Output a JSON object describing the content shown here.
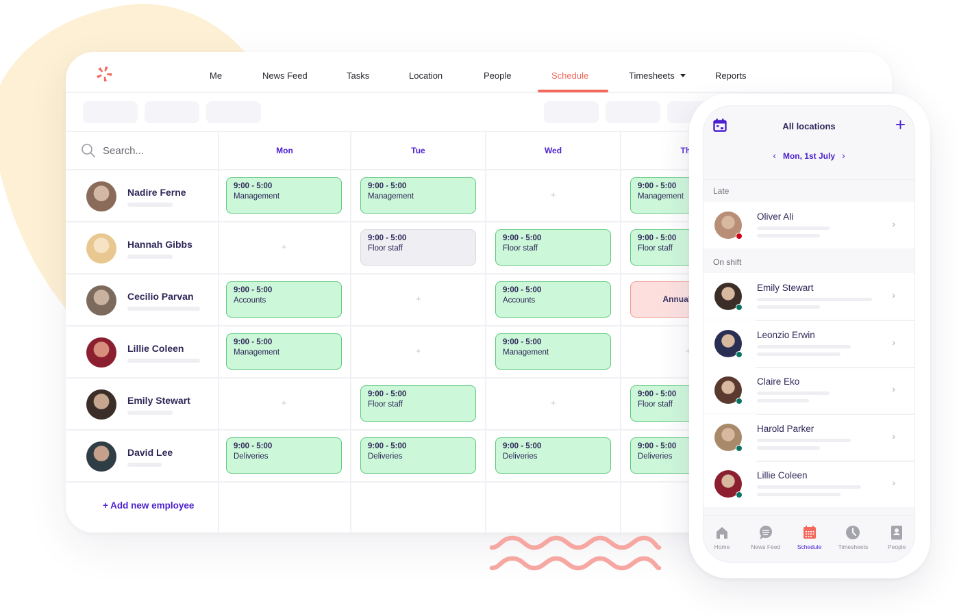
{
  "brand": {
    "accent": "#f4685d",
    "primary": "#4b1fcf",
    "text": "#2d2757",
    "shift_green": "#ccf7d9",
    "shift_grey": "#eeeef3",
    "shift_red": "#fde0de",
    "status_late": "#d0021b",
    "status_on_shift": "#0a7363"
  },
  "nav": {
    "logo": "asterisk-logo-icon",
    "items": [
      {
        "label": "Me"
      },
      {
        "label": "News Feed"
      },
      {
        "label": "Tasks"
      },
      {
        "label": "Location"
      },
      {
        "label": "People"
      },
      {
        "label": "Schedule",
        "active": true
      },
      {
        "label": "Timesheets",
        "has_dropdown": true
      },
      {
        "label": "Reports"
      }
    ]
  },
  "search": {
    "placeholder": "Search..."
  },
  "days": [
    "Mon",
    "Tue",
    "Wed",
    "Thu"
  ],
  "employees": [
    {
      "name": "Nadire Ferne",
      "shifts": [
        {
          "time": "9:00 - 5:00",
          "role": "Management",
          "state": "published"
        },
        {
          "time": "9:00 - 5:00",
          "role": "Management",
          "state": "published"
        },
        null,
        {
          "time": "9:00 - 5:00",
          "role": "Management",
          "state": "published"
        }
      ]
    },
    {
      "name": "Hannah Gibbs",
      "shifts": [
        null,
        {
          "time": "9:00 - 5:00",
          "role": "Floor staff",
          "state": "draft"
        },
        {
          "time": "9:00 - 5:00",
          "role": "Floor staff",
          "state": "published"
        },
        {
          "time": "9:00 - 5:00",
          "role": "Floor staff",
          "state": "published"
        }
      ]
    },
    {
      "name": "Cecilio Parvan",
      "shifts": [
        {
          "time": "9:00 - 5:00",
          "role": "Accounts",
          "state": "published"
        },
        null,
        {
          "time": "9:00 - 5:00",
          "role": "Accounts",
          "state": "published"
        },
        {
          "leave": "Annual leave",
          "state": "leave"
        }
      ]
    },
    {
      "name": "Lillie Coleen",
      "shifts": [
        {
          "time": "9:00 - 5:00",
          "role": "Management",
          "state": "published"
        },
        null,
        {
          "time": "9:00 - 5:00",
          "role": "Management",
          "state": "published"
        },
        null
      ]
    },
    {
      "name": "Emily Stewart",
      "shifts": [
        null,
        {
          "time": "9:00 - 5:00",
          "role": "Floor staff",
          "state": "published"
        },
        null,
        {
          "time": "9:00 - 5:00",
          "role": "Floor staff",
          "state": "published"
        }
      ]
    },
    {
      "name": "David Lee",
      "shifts": [
        {
          "time": "9:00 - 5:00",
          "role": "Deliveries",
          "state": "published"
        },
        {
          "time": "9:00 - 5:00",
          "role": "Deliveries",
          "state": "published"
        },
        {
          "time": "9:00 - 5:00",
          "role": "Deliveries",
          "state": "published"
        },
        {
          "time": "9:00 - 5:00",
          "role": "Deliveries",
          "state": "published"
        }
      ]
    }
  ],
  "add_employee_label": "+ Add new employee",
  "empty_cell_symbol": "+",
  "mobile": {
    "title": "All locations",
    "add_symbol": "+",
    "date": "Mon, 1st July",
    "prev_symbol": "‹",
    "next_symbol": "›",
    "sections": [
      {
        "label": "Late",
        "people": [
          {
            "name": "Oliver Ali",
            "status": "late"
          }
        ]
      },
      {
        "label": "On shift",
        "people": [
          {
            "name": "Emily Stewart",
            "status": "on-shift"
          },
          {
            "name": "Leonzio Erwin",
            "status": "on-shift"
          },
          {
            "name": "Claire Eko",
            "status": "on-shift"
          },
          {
            "name": "Harold Parker",
            "status": "on-shift"
          },
          {
            "name": "Lillie Coleen",
            "status": "on-shift"
          }
        ]
      }
    ],
    "chevron": "›",
    "tabs": [
      {
        "label": "Home",
        "icon": "home-icon"
      },
      {
        "label": "News Feed",
        "icon": "chat-icon"
      },
      {
        "label": "Schedule",
        "icon": "calendar-icon",
        "active": true
      },
      {
        "label": "Timesheets",
        "icon": "clock-icon"
      },
      {
        "label": "People",
        "icon": "contact-book-icon"
      }
    ]
  }
}
